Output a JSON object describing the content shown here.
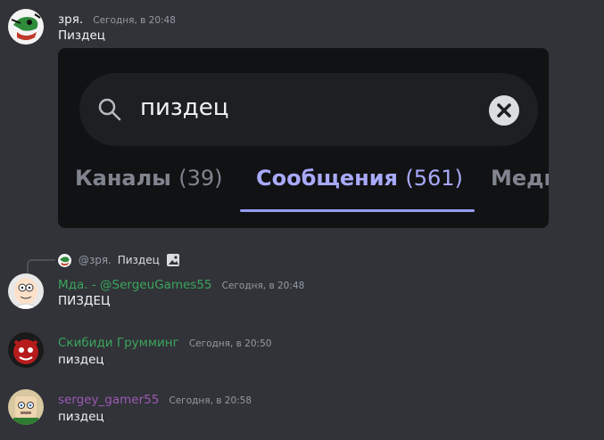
{
  "messages": [
    {
      "author": "зря.",
      "time": "Сегодня, в 20:48",
      "text": "Пиздец",
      "color": "#f2f3f5"
    },
    {
      "author": "Мда. - @SergeuGames55",
      "time": "Сегодня, в 20:48",
      "text": "ПИЗДЕЦ",
      "color": "#3ba55c"
    },
    {
      "author": "Скибиди Грумминг",
      "time": "Сегодня, в 20:50",
      "text": "пиздец",
      "color": "#3ba55c"
    },
    {
      "author": "sergey_gamer55",
      "time": "Сегодня, в 20:58",
      "text": "пиздец",
      "color": "#9b59b6"
    }
  ],
  "embed": {
    "search_query": "пиздец",
    "tabs": [
      {
        "label": "Каналы",
        "count": "(39)"
      },
      {
        "label": "Сообщения",
        "count": "(561)"
      },
      {
        "label": "Меди"
      }
    ],
    "active_tab": "Сообщения",
    "accent": "#949cf7"
  },
  "reply": {
    "author": "@зря.",
    "text": "Пиздец",
    "icon": "image-icon"
  }
}
